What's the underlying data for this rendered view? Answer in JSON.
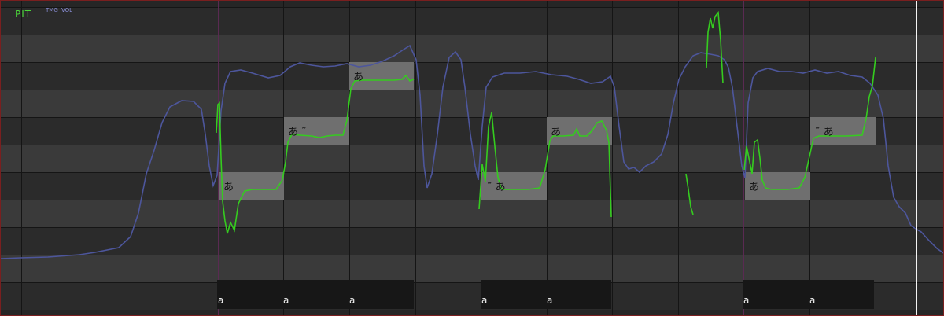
{
  "editor": {
    "tabs": [
      {
        "label": "PIT",
        "active": true,
        "color": "#4bd63a"
      },
      {
        "label": "TMG",
        "active": false,
        "color": "#8a8fd8"
      },
      {
        "label": "VOL",
        "active": false,
        "color": "#8a8fd8"
      }
    ],
    "notes": [
      {
        "lyric": "あ"
      },
      {
        "lyric": "あ ˜"
      },
      {
        "lyric": "あ"
      },
      {
        "lyric": "˜ あ"
      },
      {
        "lyric": "あ"
      },
      {
        "lyric": "あ"
      },
      {
        "lyric": "˜ あ"
      }
    ],
    "phonemes": [
      {
        "label": "a"
      },
      {
        "label": "a"
      },
      {
        "label": "a"
      },
      {
        "label": "a"
      },
      {
        "label": "a"
      },
      {
        "label": "a"
      },
      {
        "label": "a"
      }
    ],
    "colors": {
      "pitch_curve": "#35cc1f",
      "volume_curve": "#4d569c",
      "note_block": "#6f6f6f",
      "playhead": "#f4f4f4",
      "bar_line": "#5a2a52"
    }
  }
}
